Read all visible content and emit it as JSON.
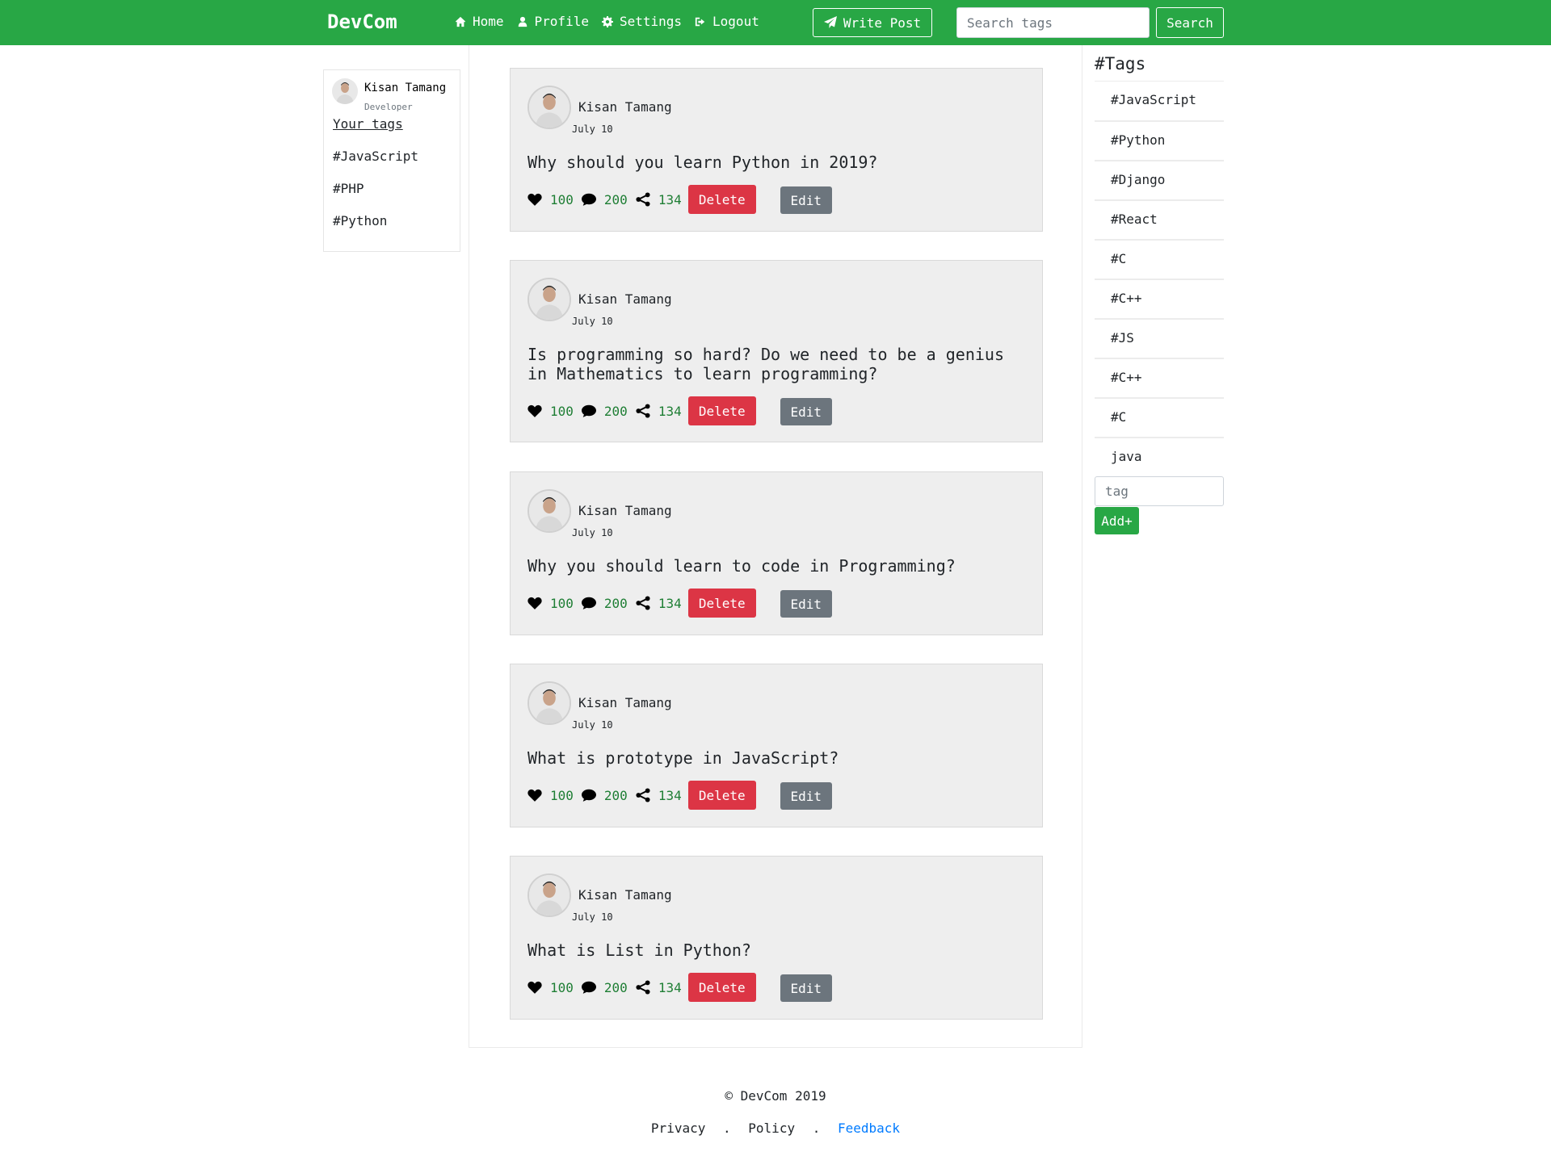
{
  "nav": {
    "brand": "DevCom",
    "links": [
      {
        "label": "Home",
        "icon": "home-icon"
      },
      {
        "label": "Profile",
        "icon": "user-icon"
      },
      {
        "label": "Settings",
        "icon": "gear-icon"
      },
      {
        "label": "Logout",
        "icon": "sign-out-icon"
      }
    ],
    "write_post": "Write Post",
    "search_placeholder": "Search tags",
    "search_button": "Search"
  },
  "profile": {
    "name": "Kisan Tamang",
    "role": "Developer",
    "your_tags_label": "Your tags",
    "tags": [
      "#JavaScript",
      "#PHP",
      "#Python"
    ]
  },
  "posts": [
    {
      "author": "Kisan Tamang",
      "date": "July 10",
      "title": "Why should you learn Python in 2019?",
      "likes": "100",
      "comments": "200",
      "shares": "134",
      "delete": "Delete",
      "edit": "Edit"
    },
    {
      "author": "Kisan Tamang",
      "date": "July 10",
      "title": "Is programming so hard? Do we need to be a genius in Mathematics to learn programming?",
      "likes": "100",
      "comments": "200",
      "shares": "134",
      "delete": "Delete",
      "edit": "Edit"
    },
    {
      "author": "Kisan Tamang",
      "date": "July 10",
      "title": "Why you should learn to code in Programming?",
      "likes": "100",
      "comments": "200",
      "shares": "134",
      "delete": "Delete",
      "edit": "Edit"
    },
    {
      "author": "Kisan Tamang",
      "date": "July 10",
      "title": "What is prototype in JavaScript?",
      "likes": "100",
      "comments": "200",
      "shares": "134",
      "delete": "Delete",
      "edit": "Edit"
    },
    {
      "author": "Kisan Tamang",
      "date": "July 10",
      "title": "What is List in Python?",
      "likes": "100",
      "comments": "200",
      "shares": "134",
      "delete": "Delete",
      "edit": "Edit"
    }
  ],
  "tags_panel": {
    "title": "#Tags",
    "tags": [
      "#JavaScript",
      "#Python",
      "#Django",
      "#React",
      "#C",
      "#C++",
      "#JS",
      "#C++",
      "#C",
      "java"
    ],
    "input_placeholder": "tag",
    "add_button": "Add+"
  },
  "footer": {
    "copyright": "© DevCom 2019",
    "privacy": "Privacy",
    "sep": ".",
    "policy": "Policy",
    "feedback": "Feedback"
  },
  "colors": {
    "brand": "#28a745",
    "danger": "#dc3545",
    "secondary": "#6c757d",
    "count": "#1e7e34",
    "link": "#007bff"
  }
}
